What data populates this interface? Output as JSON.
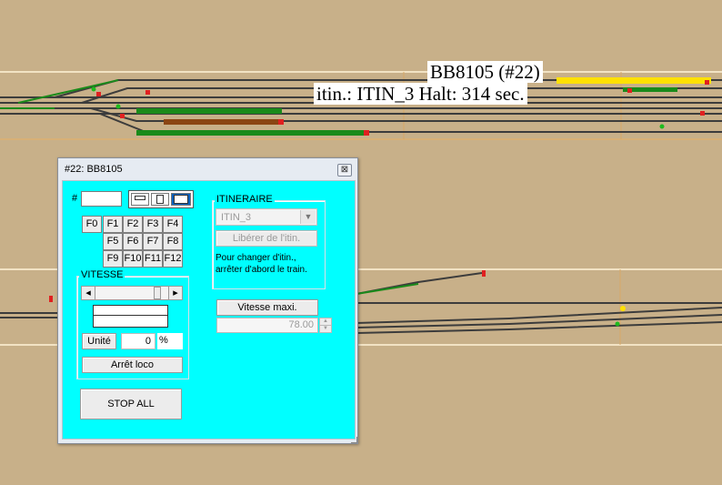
{
  "tooltip": {
    "line1": "BB8105 (#22)",
    "line2": "itin.: ITIN_3  Halt: 314 sec."
  },
  "window": {
    "title": "#22: BB8105",
    "close_glyph": "⊠"
  },
  "controls": {
    "address_label": "#",
    "address_value": "",
    "function_keys": [
      "F0",
      "F1",
      "F2",
      "F3",
      "F4",
      "F5",
      "F6",
      "F7",
      "F8",
      "F9",
      "F10",
      "F11",
      "F12"
    ],
    "speed_group_label": "VITESSE",
    "scroll_left": "◂",
    "scroll_right": "▸",
    "slider_level": 0.88,
    "unit_button": "Unité",
    "speed_value": "0",
    "speed_unit": "%",
    "stop_loco_button": "Arrêt loco",
    "stop_all_button": "STOP ALL"
  },
  "itinerary": {
    "group_label": "ITINERAIRE",
    "selected": "ITIN_3",
    "release_button": "Libérer de l'itin.",
    "note": "Pour changer d'itin., arrêter d'abord le train."
  },
  "max_speed": {
    "button": "Vitesse maxi.",
    "value": "78.00"
  },
  "colors": {
    "background": "#c8b089",
    "panel": "#00ffff",
    "track": "#3c3c3c",
    "occupied": "#1a8a1a",
    "train_yellow": "#ffe100",
    "signal_red": "#e02020"
  }
}
